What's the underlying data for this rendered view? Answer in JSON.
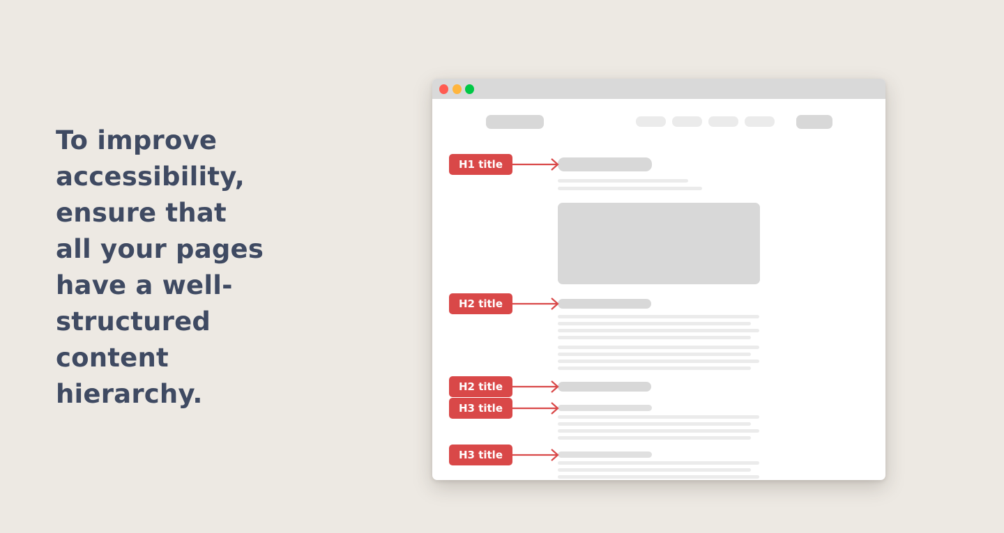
{
  "headline": "To improve accessibility, ensure that all your pages have a well-structured content hierarchy.",
  "colors": {
    "background": "#ede9e3",
    "text": "#3f4a62",
    "label": "#d94848",
    "traffic_red": "#ff5b51",
    "traffic_yellow": "#ffb53d",
    "traffic_green": "#00c845",
    "placeholder_dark": "#d8d8d8",
    "placeholder_light": "#ebebeb"
  },
  "browser": {
    "window_controls": [
      "close",
      "minimize",
      "maximize"
    ],
    "nav_links_count": 4
  },
  "labels": [
    {
      "text": "H1 title"
    },
    {
      "text": "H2 title"
    },
    {
      "text": "H2 title"
    },
    {
      "text": "H3 title"
    },
    {
      "text": "H3 title"
    }
  ]
}
